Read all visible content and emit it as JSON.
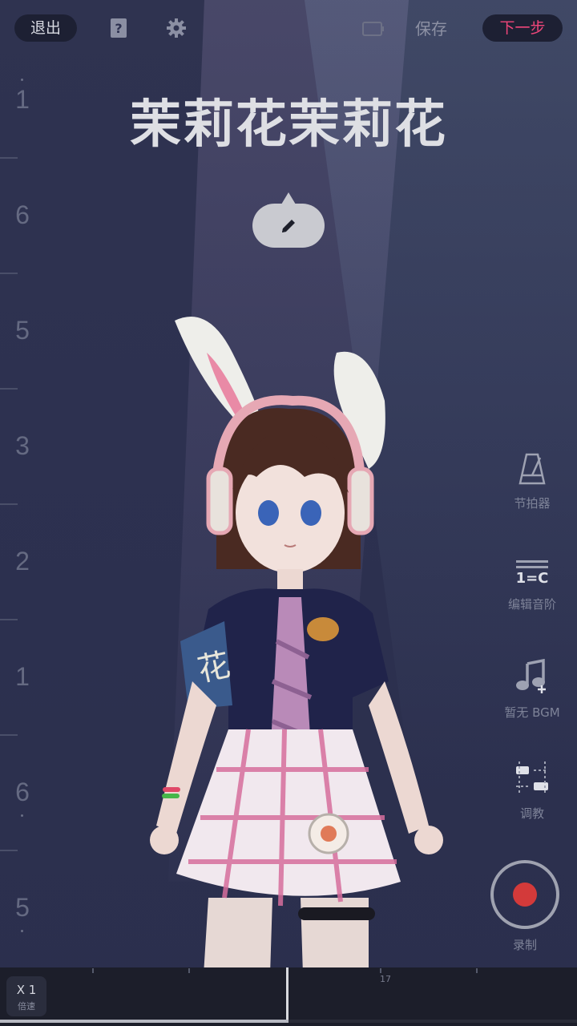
{
  "top_bar": {
    "exit_label": "退出",
    "help_icon": "question-book-icon",
    "settings_icon": "gear-icon",
    "battery_icon": "battery-icon",
    "save_label": "保存",
    "next_label": "下一步"
  },
  "ruler": {
    "numbers": [
      "1",
      "6",
      "5",
      "3",
      "2",
      "1",
      "6",
      "5"
    ]
  },
  "song": {
    "title": "茉莉花茉莉花",
    "edit_icon": "pencil-icon"
  },
  "tools": {
    "metronome_label": "节拍器",
    "scale_label": "编辑音阶",
    "scale_icon_text": "1=C",
    "bgm_label": "暂无 BGM",
    "tune_label": "调教",
    "record_label": "录制"
  },
  "bottom": {
    "speed_value": "X 1",
    "speed_label": "倍速",
    "timeline_tick": "17",
    "progress": 0.5
  },
  "colors": {
    "accent": "#f0467a",
    "record": "#d33a3a",
    "background": "#2f3350"
  }
}
